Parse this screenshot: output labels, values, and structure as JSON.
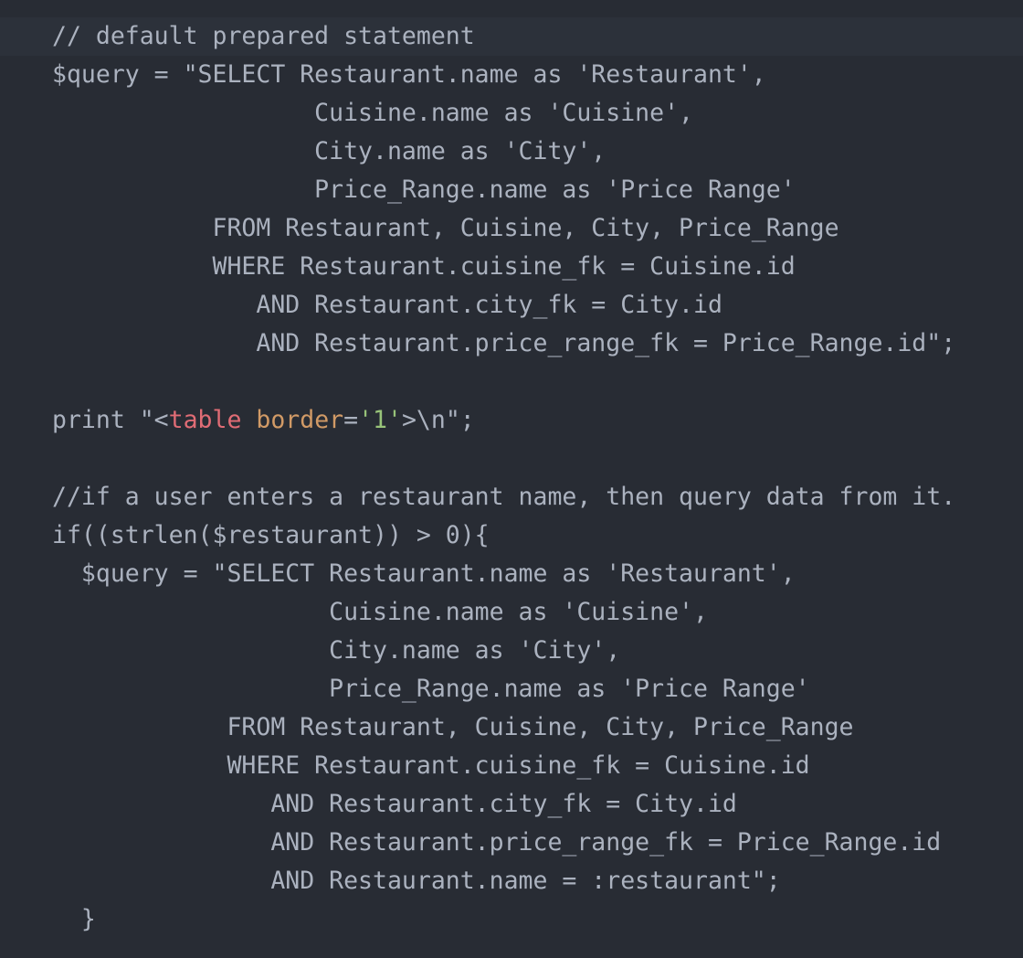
{
  "editor": {
    "lines": [
      "// default prepared statement",
      "$query = \"SELECT Restaurant.name as 'Restaurant',",
      "                  Cuisine.name as 'Cuisine',",
      "                  City.name as 'City',",
      "                  Price_Range.name as 'Price Range'",
      "           FROM Restaurant, Cuisine, City, Price_Range",
      "           WHERE Restaurant.cuisine_fk = Cuisine.id",
      "              AND Restaurant.city_fk = City.id",
      "              AND Restaurant.price_range_fk = Price_Range.id\";",
      "",
      "",
      "",
      "//if a user enters a restaurant name, then query data from it.",
      "if((strlen($restaurant)) > 0){",
      "  $query = \"SELECT Restaurant.name as 'Restaurant',",
      "                   Cuisine.name as 'Cuisine',",
      "                   City.name as 'City',",
      "                   Price_Range.name as 'Price Range'",
      "            FROM Restaurant, Cuisine, City, Price_Range",
      "            WHERE Restaurant.cuisine_fk = Cuisine.id",
      "               AND Restaurant.city_fk = City.id",
      "               AND Restaurant.price_range_fk = Price_Range.id",
      "               AND Restaurant.name = :restaurant\";",
      "  }"
    ],
    "print_line": {
      "prefix": "print \"<",
      "tag": "table",
      "space": " ",
      "attr": "border",
      "eq": "=",
      "value": "'1'",
      "suffix": ">\\n\";"
    },
    "colors": {
      "background": "#282c34",
      "text": "#abb2bf",
      "tag": "#e06c75",
      "attribute": "#d19a66",
      "string": "#98c379"
    }
  }
}
